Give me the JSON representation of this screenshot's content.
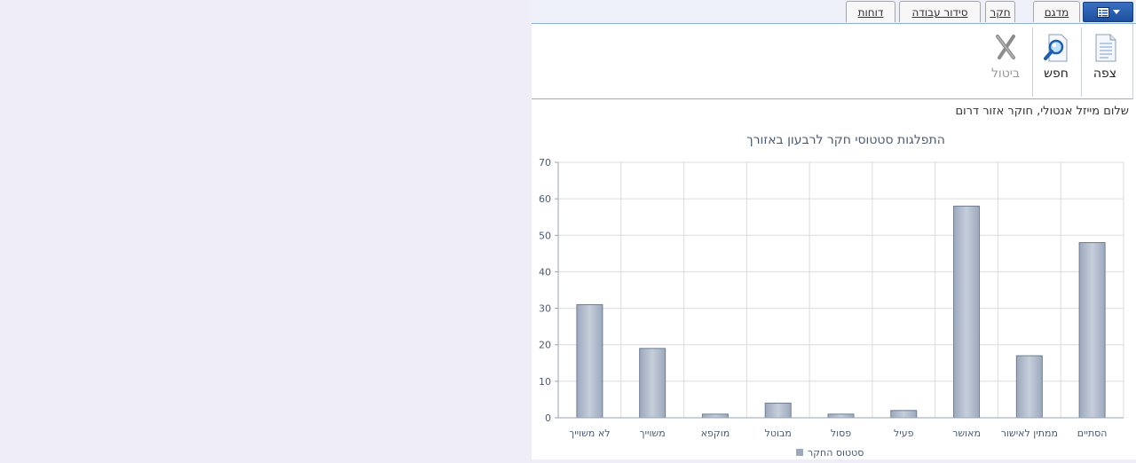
{
  "tabs": [
    {
      "label": "מדגם"
    },
    {
      "label": "חקר"
    },
    {
      "label": "סידור עבודה"
    },
    {
      "label": "דוחות"
    }
  ],
  "toolbar": {
    "view_label": "צפה",
    "search_label": "חפש",
    "cancel_label": "ביטול"
  },
  "greeting": "שלום מייזל אנטולי, חוקר אזור דרום",
  "colors": {
    "bar_light": "#c6cedb",
    "bar_dark": "#9ca8bc",
    "bar_stroke": "#6f7d93",
    "grid": "#dcdcdc",
    "text": "#4a5a73"
  },
  "chart_data": {
    "type": "bar",
    "title": "התפלגות סטטוסי חקר לרבעון באזורך",
    "categories": [
      "הסתיים",
      "ממתין לאישור",
      "מאושר",
      "פעיל",
      "פסול",
      "מבוטל",
      "מוקפא",
      "משוייך",
      "לא משוייך"
    ],
    "series": [
      {
        "name": "סטטוס החקר",
        "values": [
          48,
          17,
          58,
          2,
          1,
          4,
          1,
          19,
          31
        ]
      }
    ],
    "ylim": [
      0,
      70
    ],
    "yticks": [
      0,
      10,
      20,
      30,
      40,
      50,
      60,
      70
    ],
    "grid": true,
    "legend": "bottom-center",
    "direction": "rtl"
  }
}
